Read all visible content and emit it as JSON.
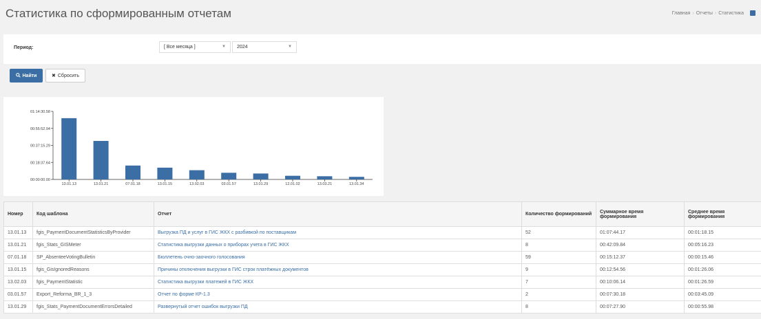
{
  "header": {
    "title": "Статистика по сформированным отчетам",
    "breadcrumbs": [
      "Главная",
      "Отчеты",
      "Статистика"
    ]
  },
  "filter": {
    "period_label": "Период:",
    "month_value": "[ Все месяца ]",
    "year_value": "2024",
    "find_label": "Найти",
    "reset_label": "Сбросить"
  },
  "colors": {
    "accent": "#3a6ea5",
    "bar": "#3a6ea5"
  },
  "icons": {
    "find": "search-icon",
    "reset": "close-icon",
    "breadcrumb": "info-icon"
  },
  "chart_data": {
    "type": "bar",
    "categories": [
      "13.01.13",
      "13.01.21",
      "07.01.18",
      "13.01.15",
      "13.02.03",
      "03.01.57",
      "13.01.29",
      "12.01.02",
      "13.03.21",
      "13.01.34"
    ],
    "values": [
      4024,
      2529,
      912,
      774,
      606,
      438,
      390,
      240,
      210,
      170
    ],
    "ytick_labels": [
      "00:00:00.00",
      "00:18:37.64",
      "00:37:15.29",
      "00:55:52.94",
      "01:14:30.58"
    ],
    "ylim": [
      0,
      4470.58
    ],
    "xlabel": "",
    "ylabel": ""
  },
  "table": {
    "headers": [
      "Номер",
      "Код шаблона",
      "Отчет",
      "Количество формирований",
      "Суммарное время формирования",
      "Среднее время формирования"
    ],
    "rows": [
      [
        "13.01.13",
        "fgis_PaymentDocumentStatisticsByProvider",
        "Выгрузка ПД и услуг в ГИС ЖКХ с разбивкой по поставщикам",
        "52",
        "01:07:44.17",
        "00:01:18.15"
      ],
      [
        "13.01.21",
        "fgis_Stats_GISMeter",
        "Статистика выгрузки данных о приборах учета в ГИС ЖКХ",
        "8",
        "00:42:09.84",
        "00:05:16.23"
      ],
      [
        "07.01.18",
        "SP_AbsenteeVotingBulletin",
        "Бюллетень очно-заочного голосования",
        "59",
        "00:15:12.37",
        "00:00:15.46"
      ],
      [
        "13.01.15",
        "fgis_GisIgnoredReasons",
        "Причины отключения выгрузки в ГИС строк платёжных документов",
        "9",
        "00:12:54.56",
        "00:01:26.06"
      ],
      [
        "13.02.03",
        "fgis_PaymentStatistic",
        "Статистика выгрузки платежей в ГИС ЖКХ",
        "7",
        "00:10:06.14",
        "00:01:26.59"
      ],
      [
        "03.01.57",
        "Export_Reforma_BR_1_3",
        "Отчет по форме КР-1.3",
        "2",
        "00:07:30.18",
        "00:03:45.09"
      ],
      [
        "13.01.29",
        "fgis_Stats_PaymentDocumentErrorsDetailed",
        "Развернутый отчет ошибок выгрузки ПД",
        "8",
        "00:07:27.90",
        "00:00:55.98"
      ]
    ]
  }
}
